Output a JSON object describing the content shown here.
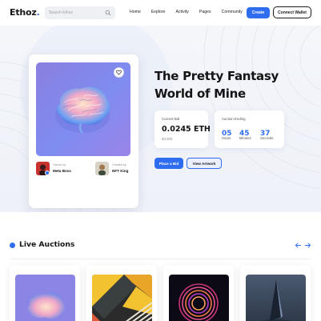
{
  "header": {
    "logo_text": "Ethoz",
    "logo_dot": ".",
    "search_placeholder": "Search Ethoz",
    "nav": [
      "Home",
      "Explore",
      "Activity",
      "Pages",
      "Community"
    ],
    "create_label": "Create",
    "connect_label": "Connect Wallet"
  },
  "hero": {
    "title_line1": "The Pretty Fantasy",
    "title_line2": "World of Mine",
    "owner": {
      "label": "Owned by",
      "name": "Meta Boss"
    },
    "creator": {
      "label": "Created by",
      "name": "NFT King"
    },
    "current_bid": {
      "caption": "Current Bid",
      "eth": "0.0245 ETH",
      "usd": "$2,505"
    },
    "auction": {
      "caption": "Auction Ending",
      "hours": "05",
      "hours_label": "Hours",
      "minutes": "45",
      "minutes_label": "Minutes",
      "seconds": "37",
      "seconds_label": "Seconds"
    },
    "place_bid_label": "Place a Bid",
    "view_artwork_label": "View Artwork"
  },
  "live_auctions": {
    "title": "Live Auctions"
  },
  "colors": {
    "accent": "#2f6df0",
    "text": "#141414",
    "hero_bg": "#f1f4f9"
  },
  "icons": [
    "search-icon",
    "heart-icon",
    "verified-icon",
    "arrow-left-icon",
    "arrow-right-icon"
  ]
}
